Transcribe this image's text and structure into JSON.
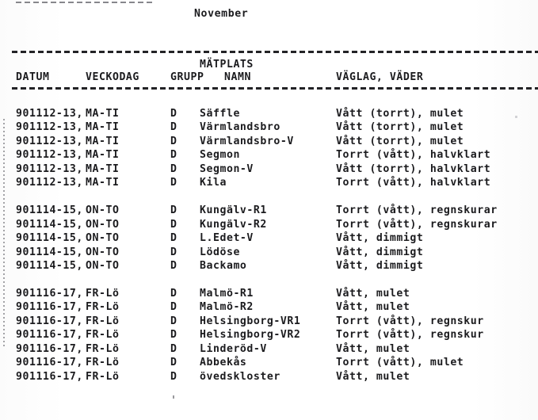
{
  "document": {
    "title": "November",
    "kind": "weather-measurement-log-printout"
  },
  "columns": {
    "group_header": "MÄTPLATS",
    "date": "DATUM",
    "weekday": "VECKODAG",
    "group": "GRUPP",
    "name": "NAMN",
    "conditions": "VÄGLAG, VÄDER"
  },
  "blocks": [
    {
      "rows": [
        {
          "date": "901112-13,",
          "weekday": "MA-TI",
          "group": "D",
          "name": "Säffle",
          "conditions": "Vått (torrt), mulet"
        },
        {
          "date": "901112-13,",
          "weekday": "MA-TI",
          "group": "D",
          "name": "Värmlandsbro",
          "conditions": "Vått (torrt), mulet"
        },
        {
          "date": "901112-13,",
          "weekday": "MA-TI",
          "group": "D",
          "name": "Värmlandsbro-V",
          "conditions": "Vått (torrt), mulet"
        },
        {
          "date": "901112-13,",
          "weekday": "MA-TI",
          "group": "D",
          "name": "Segmon",
          "conditions": "Torrt (vått), halvklart"
        },
        {
          "date": "901112-13,",
          "weekday": "MA-TI",
          "group": "D",
          "name": "Segmon-V",
          "conditions": "Vått (torrt), halvklart"
        },
        {
          "date": "901112-13,",
          "weekday": "MA-TI",
          "group": "D",
          "name": "Kila",
          "conditions": "Torrt (vått), halvklart"
        }
      ]
    },
    {
      "rows": [
        {
          "date": "901114-15,",
          "weekday": "ON-TO",
          "group": "D",
          "name": "Kungälv-R1",
          "conditions": "Torrt (vått), regnskurar"
        },
        {
          "date": "901114-15,",
          "weekday": "ON-TO",
          "group": "D",
          "name": "Kungälv-R2",
          "conditions": "Torrt (vått), regnskurar"
        },
        {
          "date": "901114-15,",
          "weekday": "ON-TO",
          "group": "D",
          "name": "L.Edet-V",
          "conditions": "Vått, dimmigt"
        },
        {
          "date": "901114-15,",
          "weekday": "ON-TO",
          "group": "D",
          "name": "Lödöse",
          "conditions": "Vått, dimmigt"
        },
        {
          "date": "901114-15,",
          "weekday": "ON-TO",
          "group": "D",
          "name": "Backamo",
          "conditions": "Vått, dimmigt"
        }
      ]
    },
    {
      "rows": [
        {
          "date": "901116-17,",
          "weekday": "FR-Lö",
          "group": "D",
          "name": "Malmö-R1",
          "conditions": "Vått, mulet"
        },
        {
          "date": "901116-17,",
          "weekday": "FR-Lö",
          "group": "D",
          "name": "Malmö-R2",
          "conditions": "Vått, mulet"
        },
        {
          "date": "901116-17,",
          "weekday": "FR-Lö",
          "group": "D",
          "name": "Helsingborg-VR1",
          "conditions": "Torrt (vått), regnskur"
        },
        {
          "date": "901116-17,",
          "weekday": "FR-Lö",
          "group": "D",
          "name": "Helsingborg-VR2",
          "conditions": "Torrt (vått), regnskur"
        },
        {
          "date": "901116-17,",
          "weekday": "FR-Lö",
          "group": "D",
          "name": "Linderöd-V",
          "conditions": "Vått, mulet"
        },
        {
          "date": "901116-17,",
          "weekday": "FR-Lö",
          "group": "D",
          "name": "Abbekås",
          "conditions": "Torrt (vått), mulet"
        },
        {
          "date": "901116-17,",
          "weekday": "FR-Lö",
          "group": "D",
          "name": "övedskloster",
          "conditions": "Vått, mulet"
        }
      ]
    }
  ]
}
